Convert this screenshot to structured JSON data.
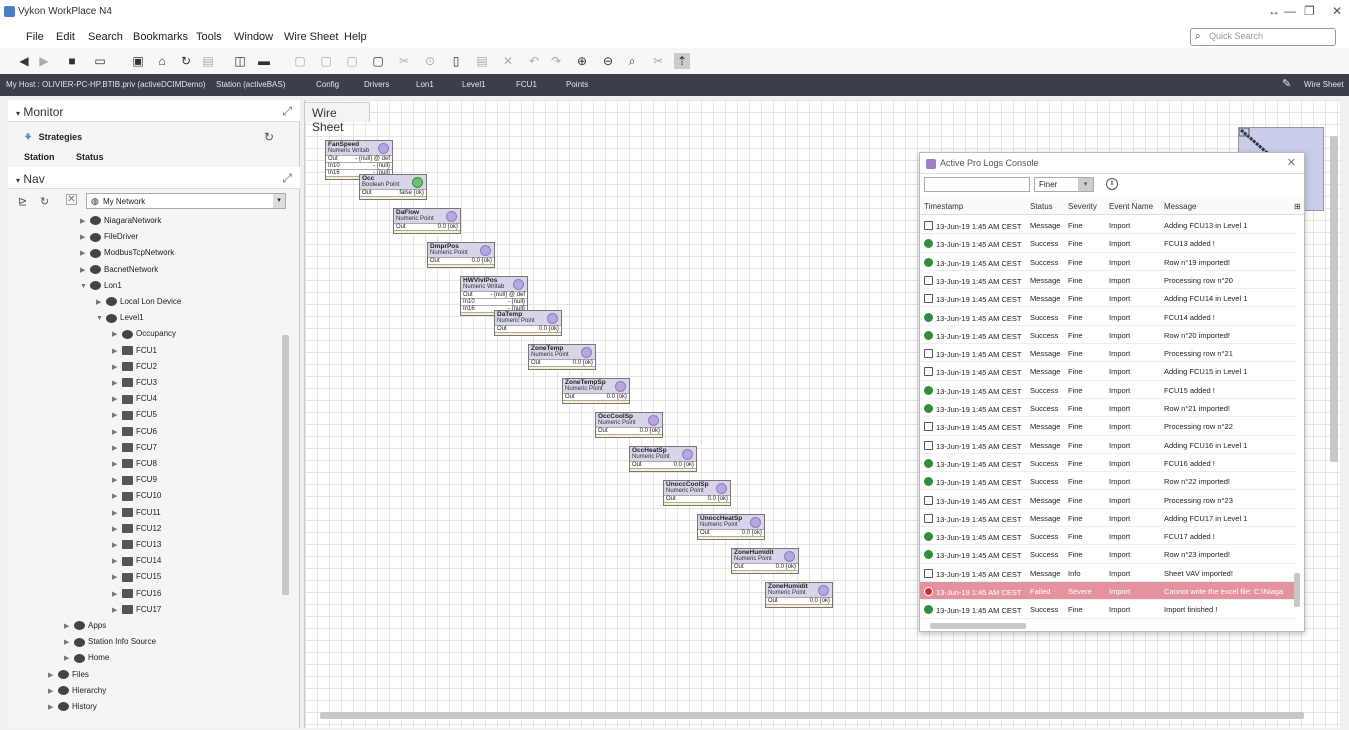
{
  "app": {
    "title": "Vykon WorkPlace N4"
  },
  "menu": [
    "File",
    "Edit",
    "Search",
    "Bookmarks",
    "Tools",
    "Window",
    "Wire Sheet",
    "Help"
  ],
  "quick_search": {
    "placeholder": "Quick Search"
  },
  "breadcrumb": {
    "items": [
      "My Host : OLIVIER-PC-HP.BTIB.priv (activeDCIMDemo)",
      "Station (activeBAS)",
      "Config",
      "Drivers",
      "Lon1",
      "Level1",
      "FCU1",
      "Points"
    ],
    "view": "Wire Sheet"
  },
  "monitor": {
    "header": "Monitor",
    "strategies": "Strategies",
    "station_label": "Station",
    "status_label": "Status"
  },
  "nav": {
    "header": "Nav",
    "network": "My Network",
    "tree": [
      "NiagaraNetwork",
      "FileDriver",
      "ModbusTcpNetwork",
      "BacnetNetwork",
      "Lon1",
      "Local Lon Device",
      "Level1",
      "Occupancy",
      "FCU1",
      "FCU2",
      "FCU3",
      "FCU4",
      "FCU5",
      "FCU6",
      "FCU7",
      "FCU8",
      "FCU9",
      "FCU10",
      "FCU11",
      "FCU12",
      "FCU13",
      "FCU14",
      "FCU15",
      "FCU16",
      "FCU17",
      "Apps",
      "Station Info Source",
      "Home",
      "Files",
      "Hierarchy",
      "History"
    ]
  },
  "wiresheet": {
    "tab": "Wire Sheet",
    "nodes": [
      {
        "name": "FanSpeed",
        "type": "Numeric Writab",
        "rows": [
          [
            "Out",
            "- {null} @ def"
          ],
          [
            "In10",
            "- {null}"
          ],
          [
            "In16",
            "- {null}"
          ]
        ]
      },
      {
        "name": "Occ",
        "type": "Boolean Point",
        "rows": [
          [
            "Out",
            "false {ok}"
          ]
        ]
      },
      {
        "name": "DaFlow",
        "type": "Numeric Point",
        "rows": [
          [
            "Out",
            "0.0 {ok}"
          ]
        ]
      },
      {
        "name": "DmprPos",
        "type": "Numeric Point",
        "rows": [
          [
            "Out",
            "0.0 {ok}"
          ]
        ]
      },
      {
        "name": "HWVlvlPos",
        "type": "Numeric Writab",
        "rows": [
          [
            "Out",
            "- {null} @ def"
          ],
          [
            "In10",
            "- {null}"
          ],
          [
            "In16",
            "- {null}"
          ]
        ]
      },
      {
        "name": "DaTemp",
        "type": "Numeric Point",
        "rows": [
          [
            "Out",
            "0.0 {ok}"
          ]
        ]
      },
      {
        "name": "ZoneTemp",
        "type": "Numeric Point",
        "rows": [
          [
            "Out",
            "0.0 {ok}"
          ]
        ]
      },
      {
        "name": "ZoneTempSp",
        "type": "Numeric Point",
        "rows": [
          [
            "Out",
            "0.0 {ok}"
          ]
        ]
      },
      {
        "name": "OccCoolSp",
        "type": "Numeric Point",
        "rows": [
          [
            "Out",
            "0.0 {ok}"
          ]
        ]
      },
      {
        "name": "OccHeatSp",
        "type": "Numeric Point",
        "rows": [
          [
            "Out",
            "0.0 {ok}"
          ]
        ]
      },
      {
        "name": "UnoccCoolSp",
        "type": "Numeric Point",
        "rows": [
          [
            "Out",
            "0.0 {ok}"
          ]
        ]
      },
      {
        "name": "UnoccHeatSp",
        "type": "Numeric Point",
        "rows": [
          [
            "Out",
            "0.0 {ok}"
          ]
        ]
      },
      {
        "name": "ZoneHumidit",
        "type": "Numeric Point",
        "rows": [
          [
            "Out",
            "0.0 {ok}"
          ]
        ]
      },
      {
        "name": "ZoneHumidit",
        "type": "Numeric Point",
        "rows": [
          [
            "Out",
            "0.0 {ok}"
          ]
        ]
      }
    ]
  },
  "console": {
    "title": "Active Pro Logs Console",
    "level": "Finer",
    "columns": [
      "Timestamp",
      "Status",
      "Severity",
      "Event Name",
      "Message"
    ],
    "rows": [
      {
        "ts": "13-Jun-19 1:45 AM CEST",
        "status": "Message",
        "sev": "Fine",
        "event": "Import",
        "msg": "Adding FCU13 in Level 1"
      },
      {
        "ts": "13-Jun-19 1:45 AM CEST",
        "status": "Success",
        "sev": "Fine",
        "event": "Import",
        "msg": "FCU13 added !"
      },
      {
        "ts": "13-Jun-19 1:45 AM CEST",
        "status": "Success",
        "sev": "Fine",
        "event": "Import",
        "msg": "Row n°19 imported!"
      },
      {
        "ts": "13-Jun-19 1:45 AM CEST",
        "status": "Message",
        "sev": "Fine",
        "event": "Import",
        "msg": "Processing row n°20"
      },
      {
        "ts": "13-Jun-19 1:45 AM CEST",
        "status": "Message",
        "sev": "Fine",
        "event": "Import",
        "msg": "Adding FCU14 in Level 1"
      },
      {
        "ts": "13-Jun-19 1:45 AM CEST",
        "status": "Success",
        "sev": "Fine",
        "event": "Import",
        "msg": "FCU14 added !"
      },
      {
        "ts": "13-Jun-19 1:45 AM CEST",
        "status": "Success",
        "sev": "Fine",
        "event": "Import",
        "msg": "Row n°20 imported!"
      },
      {
        "ts": "13-Jun-19 1:45 AM CEST",
        "status": "Message",
        "sev": "Fine",
        "event": "Import",
        "msg": "Processing row n°21"
      },
      {
        "ts": "13-Jun-19 1:45 AM CEST",
        "status": "Message",
        "sev": "Fine",
        "event": "Import",
        "msg": "Adding FCU15 in Level 1"
      },
      {
        "ts": "13-Jun-19 1:45 AM CEST",
        "status": "Success",
        "sev": "Fine",
        "event": "Import",
        "msg": "FCU15 added !"
      },
      {
        "ts": "13-Jun-19 1:45 AM CEST",
        "status": "Success",
        "sev": "Fine",
        "event": "Import",
        "msg": "Row n°21 imported!"
      },
      {
        "ts": "13-Jun-19 1:45 AM CEST",
        "status": "Message",
        "sev": "Fine",
        "event": "Import",
        "msg": "Processing row n°22"
      },
      {
        "ts": "13-Jun-19 1:45 AM CEST",
        "status": "Message",
        "sev": "Fine",
        "event": "Import",
        "msg": "Adding FCU16 in Level 1"
      },
      {
        "ts": "13-Jun-19 1:45 AM CEST",
        "status": "Success",
        "sev": "Fine",
        "event": "Import",
        "msg": "FCU16 added !"
      },
      {
        "ts": "13-Jun-19 1:45 AM CEST",
        "status": "Success",
        "sev": "Fine",
        "event": "Import",
        "msg": "Row n°22 imported!"
      },
      {
        "ts": "13-Jun-19 1:45 AM CEST",
        "status": "Message",
        "sev": "Fine",
        "event": "Import",
        "msg": "Processing row n°23"
      },
      {
        "ts": "13-Jun-19 1:45 AM CEST",
        "status": "Message",
        "sev": "Fine",
        "event": "Import",
        "msg": "Adding FCU17 in Level 1"
      },
      {
        "ts": "13-Jun-19 1:45 AM CEST",
        "status": "Success",
        "sev": "Fine",
        "event": "Import",
        "msg": "FCU17 added !"
      },
      {
        "ts": "13-Jun-19 1:45 AM CEST",
        "status": "Success",
        "sev": "Fine",
        "event": "Import",
        "msg": "Row n°23 imported!"
      },
      {
        "ts": "13-Jun-19 1:45 AM CEST",
        "status": "Message",
        "sev": "Info",
        "event": "Import",
        "msg": "Sheet VAV imported!"
      },
      {
        "ts": "13-Jun-19 1:45 AM CEST",
        "status": "Failed",
        "sev": "Severe",
        "event": "Import",
        "msg": "Cannot write the excel file: C:\\Niaga"
      },
      {
        "ts": "13-Jun-19 1:45 AM CEST",
        "status": "Success",
        "sev": "Fine",
        "event": "Import",
        "msg": "Import finished !"
      }
    ]
  },
  "colors": {
    "breadcrumb_bg": "#3a3f4a",
    "failed_row": "#e4929d",
    "node_fill": "#d9d4e8"
  }
}
